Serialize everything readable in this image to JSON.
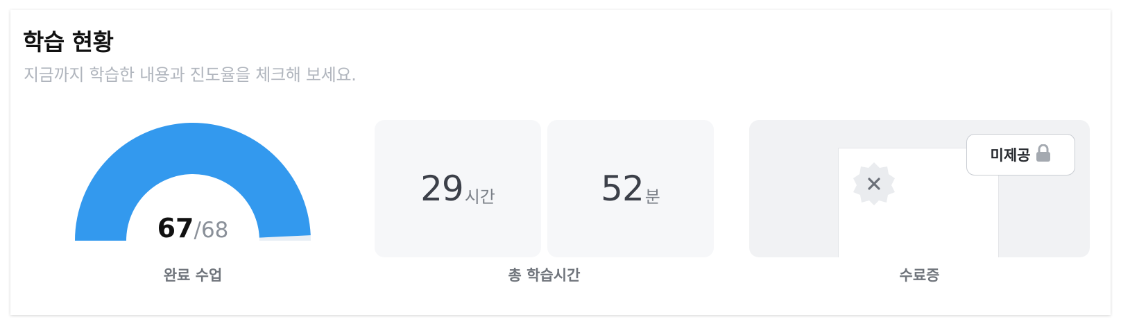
{
  "header": {
    "title": "학습 현황",
    "subtitle": "지금까지 학습한 내용과 진도율을 체크해 보세요."
  },
  "progress": {
    "completed": "67",
    "total": "/68",
    "completed_value": 67,
    "total_value": 68,
    "label": "완료 수업",
    "color": "#3399ee"
  },
  "study_time": {
    "hours": "29",
    "hours_unit": "시간",
    "minutes": "52",
    "minutes_unit": "분",
    "label": "총 학습시간"
  },
  "certificate": {
    "status": "미제공",
    "label": "수료증",
    "badge_icon": "close-icon",
    "lock_icon": "lock-icon"
  }
}
